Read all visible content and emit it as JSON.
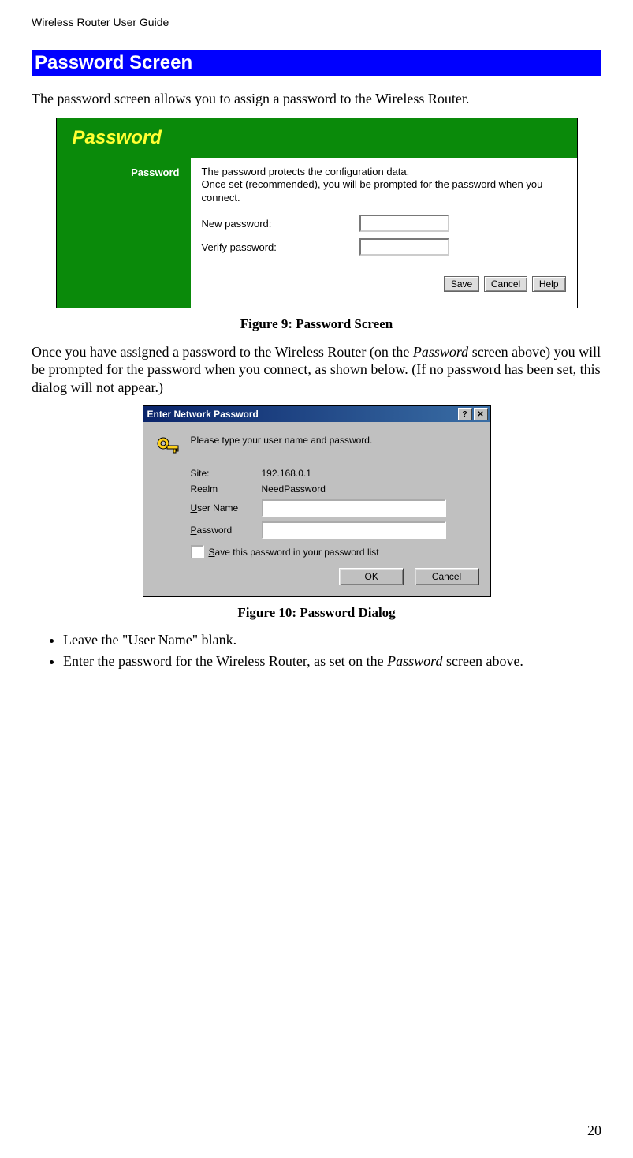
{
  "header": {
    "text": "Wireless Router User Guide"
  },
  "section": {
    "title": "Password Screen"
  },
  "intro": {
    "text": "The password screen allows you to assign a password to the Wireless Router."
  },
  "fig9": {
    "banner_title": "Password",
    "side_label": "Password",
    "description": "The password protects the configuration data.\nOnce set (recommended), you will be prompted for the password when you connect.",
    "rows": {
      "new_label": "New password:",
      "verify_label": "Verify password:"
    },
    "buttons": {
      "save": "Save",
      "cancel": "Cancel",
      "help": "Help"
    },
    "caption": "Figure 9: Password Screen"
  },
  "mid_para": {
    "pre": "Once you have assigned a password to the Wireless Router (on the ",
    "italic1": "Password",
    "post": " screen above) you will be prompted for the password when you connect, as shown below. (If no password has been set, this dialog will not appear.)"
  },
  "fig10": {
    "title": "Enter Network Password",
    "prompt": "Please type your user name and password.",
    "labels": {
      "site": "Site:",
      "realm": "Realm",
      "user": "User Name",
      "pass": "Password",
      "save_check": "Save this password in your password list"
    },
    "values": {
      "site": "192.168.0.1",
      "realm": "NeedPassword"
    },
    "buttons": {
      "ok": "OK",
      "cancel": "Cancel"
    },
    "caption": "Figure 10: Password Dialog"
  },
  "bullets": {
    "b1": "Leave the \"User Name\" blank.",
    "b2_pre": "Enter the password for the Wireless Router, as set on the ",
    "b2_italic": "Password",
    "b2_post": " screen above."
  },
  "page_number": "20",
  "icons": {
    "help": "?",
    "close": "✕"
  }
}
